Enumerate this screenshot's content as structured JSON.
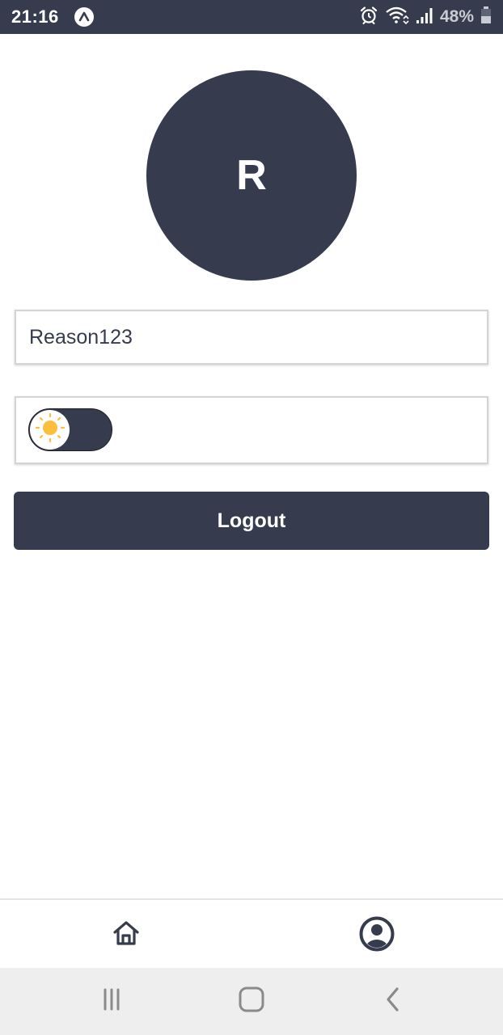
{
  "status_bar": {
    "time": "21:16",
    "app_icon": "expo-icon",
    "icons": [
      "alarm-icon",
      "wifi-icon",
      "signal-icon"
    ],
    "battery_text": "48%",
    "battery_icon": "battery-icon",
    "background_color": "#363c4d"
  },
  "profile": {
    "avatar_letter": "R",
    "username": "Reason123"
  },
  "theme": {
    "mode": "light",
    "toggle_icon": "sun-icon",
    "toggle_on": false,
    "sun_color": "#fbbf3c"
  },
  "actions": {
    "logout_label": "Logout"
  },
  "tab_bar": {
    "items": [
      {
        "icon": "home-icon",
        "name": "home"
      },
      {
        "icon": "user-circle-icon",
        "name": "profile"
      }
    ]
  },
  "system_nav": {
    "icons": [
      "recent-apps-icon",
      "home-button-icon",
      "back-icon"
    ]
  },
  "colors": {
    "primary": "#363c4d",
    "background": "#ffffff"
  }
}
